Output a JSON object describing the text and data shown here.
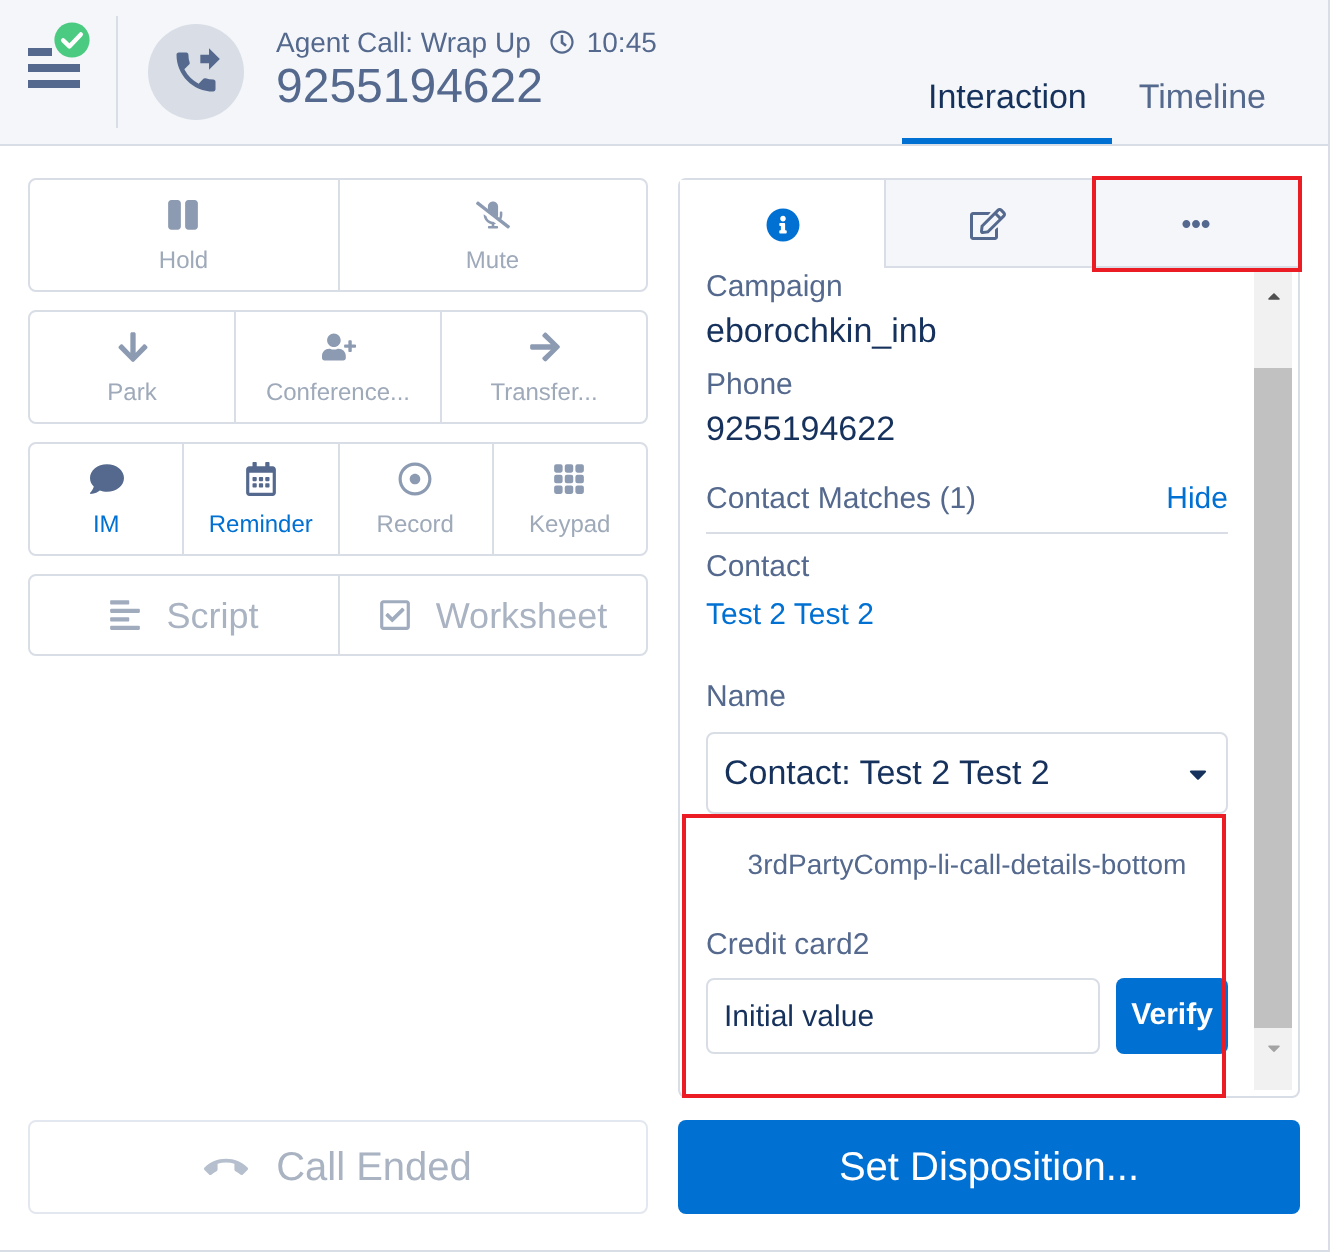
{
  "call": {
    "title": "Agent Call: Wrap Up",
    "time": "10:45",
    "number": "9255194622"
  },
  "tabs": [
    {
      "label": "Interaction",
      "selected": true
    },
    {
      "label": "Timeline",
      "selected": false
    }
  ],
  "control_groups": [
    {
      "kind": "stacked",
      "buttons": [
        {
          "kind": "hold",
          "label": "Hold",
          "disabled": true
        },
        {
          "kind": "mute",
          "label": "Mute",
          "disabled": true
        }
      ]
    },
    {
      "kind": "stacked",
      "buttons": [
        {
          "kind": "park",
          "label": "Park",
          "disabled": true
        },
        {
          "kind": "conference",
          "label": "Conference...",
          "disabled": true
        },
        {
          "kind": "transfer",
          "label": "Transfer...",
          "disabled": true
        }
      ]
    },
    {
      "kind": "stacked",
      "buttons": [
        {
          "kind": "im",
          "label": "IM",
          "disabled": false
        },
        {
          "kind": "reminder",
          "label": "Reminder",
          "disabled": false
        },
        {
          "kind": "record",
          "label": "Record",
          "disabled": true
        },
        {
          "kind": "keypad",
          "label": "Keypad",
          "disabled": true
        }
      ]
    },
    {
      "kind": "inline",
      "buttons": [
        {
          "kind": "script",
          "label": "Script",
          "disabled": true
        },
        {
          "kind": "worksheet",
          "label": "Worksheet",
          "disabled": true
        }
      ]
    }
  ],
  "detail_tabs": [
    {
      "kind": "info",
      "selected": true,
      "highlighted": false
    },
    {
      "kind": "edit",
      "selected": false,
      "highlighted": false
    },
    {
      "kind": "more",
      "selected": false,
      "highlighted": true
    }
  ],
  "details": {
    "fields": [
      {
        "label": "Campaign",
        "value": "eborochkin_inb"
      },
      {
        "label": "Phone",
        "value": "9255194622"
      }
    ],
    "contact_matches": {
      "title": "Contact Matches (1)",
      "action": "Hide",
      "contact_label": "Contact",
      "contact_link": "Test 2 Test 2"
    },
    "name_select": {
      "label": "Name",
      "value": "Contact: Test 2 Test 2"
    },
    "third_party": {
      "highlighted": true,
      "title": "3rdPartyComp-li-call-details-bottom",
      "field_label": "Credit card2",
      "field_value": "Initial value",
      "button": "Verify"
    }
  },
  "footer": {
    "call_ended": {
      "label": "Call Ended",
      "disabled": true
    },
    "disposition": {
      "label": "Set Disposition..."
    }
  }
}
